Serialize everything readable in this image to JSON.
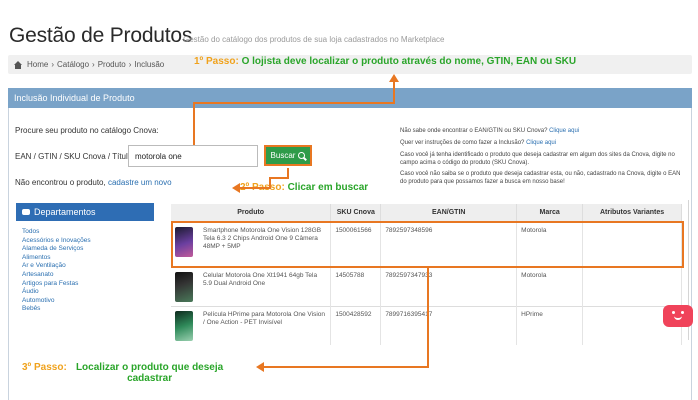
{
  "header": {
    "title": "Gestão de Produtos",
    "subtitle": "Gestão do catálogo dos produtos de sua loja cadastrados no Marketplace"
  },
  "breadcrumb": {
    "items": [
      "Home",
      "›",
      "Catálogo",
      "›",
      "Produto",
      "›",
      "Inclusão"
    ]
  },
  "annotations": {
    "step1": {
      "number": "1º Passo:",
      "text": "O lojista deve localizar o produto através do nome, GTIN, EAN ou SKU"
    },
    "step2": {
      "number": "2º Passo:",
      "text": "Clicar em buscar"
    },
    "step3": {
      "number": "3º Passo:",
      "text": "Localizar o produto que deseja cadastrar"
    }
  },
  "panel": {
    "title": "Inclusão Individual de Produto",
    "search_label": "Procure seu produto no catálogo Cnova:",
    "code_label": "EAN / GTIN / SKU Cnova / Título",
    "search_value": "motorola one",
    "search_button": "Buscar",
    "not_found_text": "Não encontrou o produto,",
    "not_found_link": "cadastre um novo"
  },
  "help": {
    "q1": "Não sabe onde encontrar o EAN/GTIN ou SKU Cnova?",
    "q1_link": "Clique aqui",
    "q2": "Quer ver instruções de como fazer a Inclusão?",
    "q2_link": "Clique aqui",
    "p1": "Caso você já tenha identificado o produto que deseja cadastrar em algum dos sites da Cnova, digite no campo acima o código do produto (SKU Cnova).",
    "p2": "Caso você não saiba se o produto que deseja cadastrar esta, ou não, cadastrado na Cnova, digite o EAN do produto para que possamos fazer a busca em nosso base!"
  },
  "departments": {
    "title": "Departamentos",
    "items": [
      "Todos",
      "Acessórios e Inovações",
      "Alameda de Serviços",
      "Alimentos",
      "Ar e Ventilação",
      "Artesanato",
      "Artigos para Festas",
      "Áudio",
      "Automotivo",
      "Bebês"
    ]
  },
  "table": {
    "columns": [
      "Produto",
      "SKU Cnova",
      "EAN/GTIN",
      "Marca",
      "Atributos Variantes"
    ],
    "rows": [
      {
        "produto": "Smartphone Motorola One Vision 128GB Tela 6.3 2 Chips Android One 9 Câmera 48MP + 5MP",
        "sku": "1500061566",
        "ean": "7892597348596",
        "marca": "Motorola",
        "atributos": ""
      },
      {
        "produto": "Celular Motorola One Xt1941 64gb Tela 5.9 Dual Android One",
        "sku": "14505788",
        "ean": "7892597347933",
        "marca": "Motorola",
        "atributos": ""
      },
      {
        "produto": "Película HPrime para Motorola One Vision / One Action - PET Invisível",
        "sku": "1500428592",
        "ean": "7899716395417",
        "marca": "HPrime",
        "atributos": ""
      }
    ]
  },
  "colors": {
    "panel_header": "#7aa3c8",
    "departments_header": "#2e6db4",
    "button_green": "#2e9b48",
    "annotation_orange": "#e87722",
    "annotation_green": "#2aa52a"
  }
}
